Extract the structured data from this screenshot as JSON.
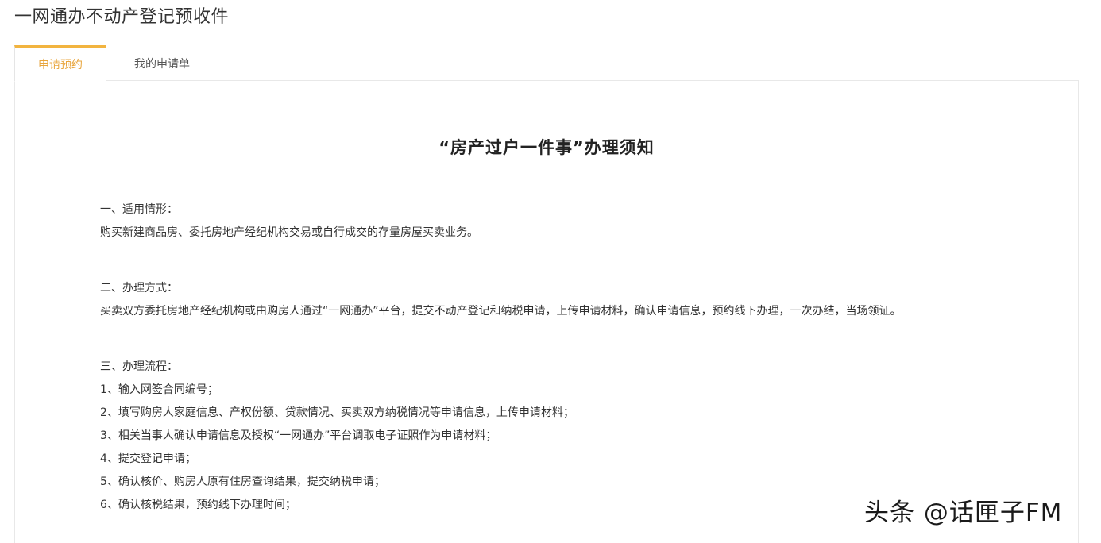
{
  "page": {
    "title": "一网通办不动产登记预收件"
  },
  "tabs": [
    {
      "label": "申请预约",
      "active": true
    },
    {
      "label": "我的申请单",
      "active": false
    }
  ],
  "notice": {
    "title": "“房产过户一件事”办理须知",
    "sections": [
      {
        "heading": "一、适用情形：",
        "text": "购买新建商品房、委托房地产经纪机构交易或自行成交的存量房屋买卖业务。"
      },
      {
        "heading": "二、办理方式：",
        "text": "买卖双方委托房地产经纪机构或由购房人通过“一网通办”平台，提交不动产登记和纳税申请，上传申请材料，确认申请信息，预约线下办理，一次办结，当场领证。"
      },
      {
        "heading": "三、办理流程：",
        "steps": [
          "1、输入网签合同编号；",
          "2、填写购房人家庭信息、产权份额、贷款情况、买卖双方纳税情况等申请信息，上传申请材料；",
          "3、相关当事人确认申请信息及授权“一网通办”平台调取电子证照作为申请材料；",
          "4、提交登记申请；",
          "5、确认核价、购房人原有住房查询结果，提交纳税申请；",
          "6、确认核税结果，预约线下办理时间；"
        ]
      }
    ]
  },
  "watermark": {
    "text": "头条 @话匣子FM"
  },
  "colors": {
    "accent": "#f2b43f",
    "active_tab_text": "#e8a53c",
    "border": "#e8e8e8"
  }
}
